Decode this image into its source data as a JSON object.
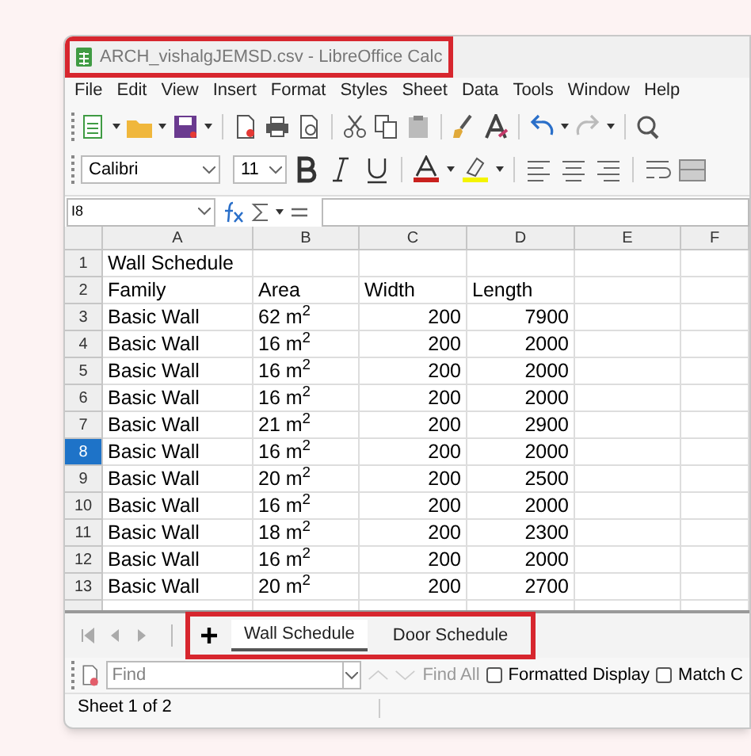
{
  "window": {
    "title": "ARCH_vishalgJEMSD.csv - LibreOffice Calc",
    "highlighted": true
  },
  "menu": [
    "File",
    "Edit",
    "View",
    "Insert",
    "Format",
    "Styles",
    "Sheet",
    "Data",
    "Tools",
    "Window",
    "Help"
  ],
  "formatting": {
    "font": "Calibri",
    "size": "11"
  },
  "formula_bar": {
    "name_box": "I8"
  },
  "columns": [
    "A",
    "B",
    "C",
    "D",
    "E",
    "F"
  ],
  "rows": [
    {
      "header": "1",
      "selected": false,
      "cells": [
        "Wall Schedule",
        "",
        "",
        "",
        "",
        ""
      ]
    },
    {
      "header": "2",
      "selected": false,
      "cells": [
        "Family",
        "Area",
        "Width",
        "Length",
        "",
        ""
      ]
    },
    {
      "header": "3",
      "selected": false,
      "cells": [
        "Basic Wall",
        "62 m$^{2}$",
        "200",
        "7900",
        "",
        ""
      ]
    },
    {
      "header": "4",
      "selected": false,
      "cells": [
        "Basic Wall",
        "16 m$^{2}$",
        "200",
        "2000",
        "",
        ""
      ]
    },
    {
      "header": "5",
      "selected": false,
      "cells": [
        "Basic Wall",
        "16 m$^{2}$",
        "200",
        "2000",
        "",
        ""
      ]
    },
    {
      "header": "6",
      "selected": false,
      "cells": [
        "Basic Wall",
        "16 m$^{2}$",
        "200",
        "2000",
        "",
        ""
      ]
    },
    {
      "header": "7",
      "selected": false,
      "cells": [
        "Basic Wall",
        "21 m$^{2}$",
        "200",
        "2900",
        "",
        ""
      ]
    },
    {
      "header": "8",
      "selected": true,
      "cells": [
        "Basic Wall",
        "16 m$^{2}$",
        "200",
        "2000",
        "",
        ""
      ]
    },
    {
      "header": "9",
      "selected": false,
      "cells": [
        "Basic Wall",
        "20 m$^{2}$",
        "200",
        "2500",
        "",
        ""
      ]
    },
    {
      "header": "10",
      "selected": false,
      "cells": [
        "Basic Wall",
        "16 m$^{2}$",
        "200",
        "2000",
        "",
        ""
      ]
    },
    {
      "header": "11",
      "selected": false,
      "cells": [
        "Basic Wall",
        "18 m$^{2}$",
        "200",
        "2300",
        "",
        ""
      ]
    },
    {
      "header": "12",
      "selected": false,
      "cells": [
        "Basic Wall",
        "16 m$^{2}$",
        "200",
        "2000",
        "",
        ""
      ]
    },
    {
      "header": "13",
      "selected": false,
      "cells": [
        "Basic Wall",
        "20 m$^{2}$",
        "200",
        "2700",
        "",
        ""
      ]
    }
  ],
  "sheet_tabs": {
    "highlighted": true,
    "tabs": [
      {
        "label": "Wall Schedule",
        "selected": true
      },
      {
        "label": "Door Schedule",
        "selected": false
      }
    ]
  },
  "find_bar": {
    "placeholder": "Find",
    "find_all": "Find All",
    "options": [
      {
        "label": "Formatted Display",
        "checked": false
      },
      {
        "label": "Match C",
        "checked": false
      }
    ]
  },
  "status_bar": {
    "sheet": "Sheet 1 of 2"
  }
}
